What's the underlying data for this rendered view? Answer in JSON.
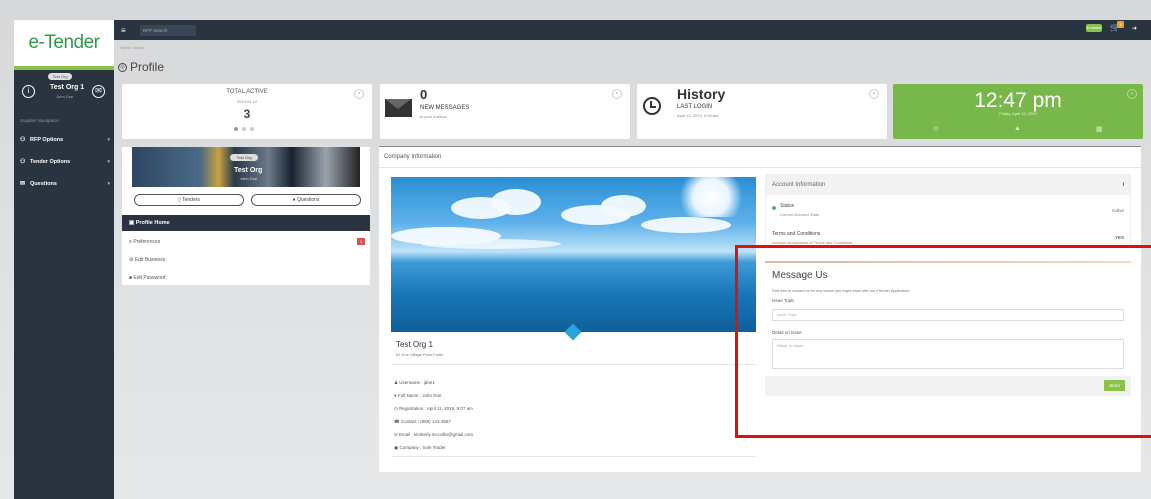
{
  "app": {
    "logo": "e-Tender",
    "breadcrumb": "Home / Active",
    "page_title": "Profile"
  },
  "sidebar": {
    "badge": "Test Org",
    "user_name": "Test Org 1",
    "user_sub": "John Doe",
    "nav_title": "Supplier Navigation",
    "items": [
      {
        "label": "RFP Options"
      },
      {
        "label": "Tender Options"
      },
      {
        "label": "Questions"
      }
    ]
  },
  "topbar": {
    "search_placeholder": "RFP Search",
    "badge": "Enabled",
    "cart_count": "1"
  },
  "stats": {
    "total": {
      "title": "TOTAL ACTIVE",
      "date": "2019-04-12",
      "count": "3"
    },
    "messages": {
      "count": "0",
      "label": "NEW MESSAGES",
      "sub": "in your mailbox"
    },
    "history": {
      "title": "History",
      "label": "LAST LOGIN",
      "sub": "April 12, 2019, 9:20 am"
    },
    "clock": {
      "time": "12:47 pm",
      "date": "Friday, April 12, 2019"
    }
  },
  "profile": {
    "banner_tag": "Test Org",
    "banner_name": "Test Org",
    "banner_sub": "John Doe",
    "btn_tenders": "Tenders",
    "btn_questions": "Questions",
    "menu_header": "Profile Home",
    "menu": [
      {
        "label": "Preferences",
        "badge": "1"
      },
      {
        "label": "Edit Business"
      },
      {
        "label": "Edit Password"
      }
    ]
  },
  "company": {
    "header": "Company Information",
    "name": "Test Org 1",
    "address": "81 Doe Village Point Fortin",
    "details": [
      "Username : jdoe1",
      "Full Name : John Doe",
      "Registration : April 11, 2019, 9:07 am",
      "Contact : (868) 123-4567",
      "Email : kimberly.mccollin@gmail.com",
      "Company : Sole Trader"
    ]
  },
  "account": {
    "title": "Account Information",
    "status_key": "Status",
    "status_desc": "Current Account State",
    "status_val": "Active",
    "terms_key": "Terms and Conditions",
    "terms_desc": "Account Acceptance of Terms and Conditions",
    "terms_val": "YES"
  },
  "message_us": {
    "title": "Message Us",
    "desc": "Feel free to contact us for any issues you might have with our eTender Application.",
    "issue_label": "Issue Topic",
    "issue_placeholder": "Issue Topic",
    "detail_label": "Detail on Issue",
    "detail_placeholder": "Detail on Issue",
    "send": "Send"
  },
  "colors": {
    "sidebar": "#2a3441",
    "accent_green": "#8bc34a",
    "clock_card": "#78b84a",
    "highlight": "#e01010"
  }
}
